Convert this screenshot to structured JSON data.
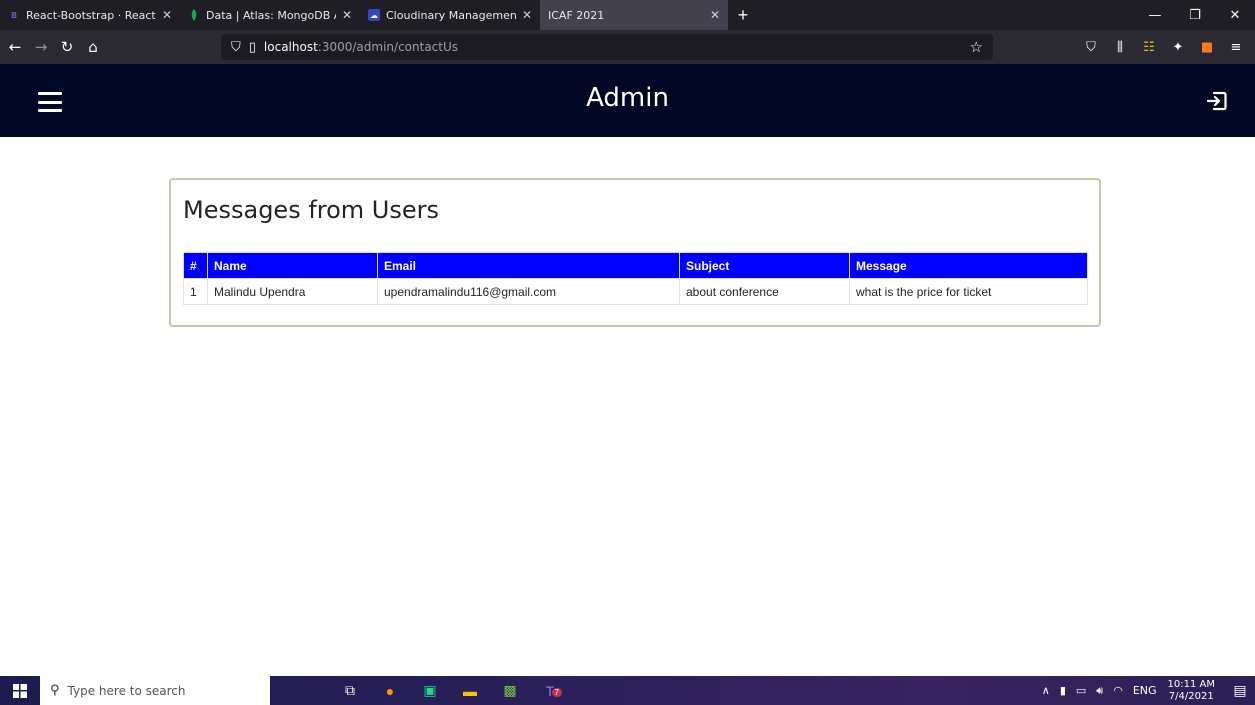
{
  "browser": {
    "tabs": [
      {
        "title": "React-Bootstrap · React-Bootstr",
        "active": false
      },
      {
        "title": "Data | Atlas: MongoDB Atlas",
        "active": false
      },
      {
        "title": "Cloudinary Management Conso",
        "active": false
      },
      {
        "title": "ICAF 2021",
        "active": true
      }
    ],
    "url_host": "localhost",
    "url_path": ":3000/admin/contactUs"
  },
  "app": {
    "title": "Admin"
  },
  "messages": {
    "title": "Messages from Users",
    "columns": [
      "#",
      "Name",
      "Email",
      "Subject",
      "Message"
    ],
    "rows": [
      [
        "1",
        "Malindu Upendra",
        "upendramalindu116@gmail.com",
        "about conference",
        "what is the price for ticket"
      ]
    ]
  },
  "taskbar": {
    "search_placeholder": "Type here to search",
    "language": "ENG",
    "time": "10:11 AM",
    "date": "7/4/2021",
    "teams_badge": "7"
  },
  "colors": {
    "header_bg": "#000826",
    "table_header_bg": "#0000ff",
    "card_border": "#c5c8a4"
  },
  "icons": {
    "menu": "hamburger-icon",
    "logout": "logout-icon"
  }
}
